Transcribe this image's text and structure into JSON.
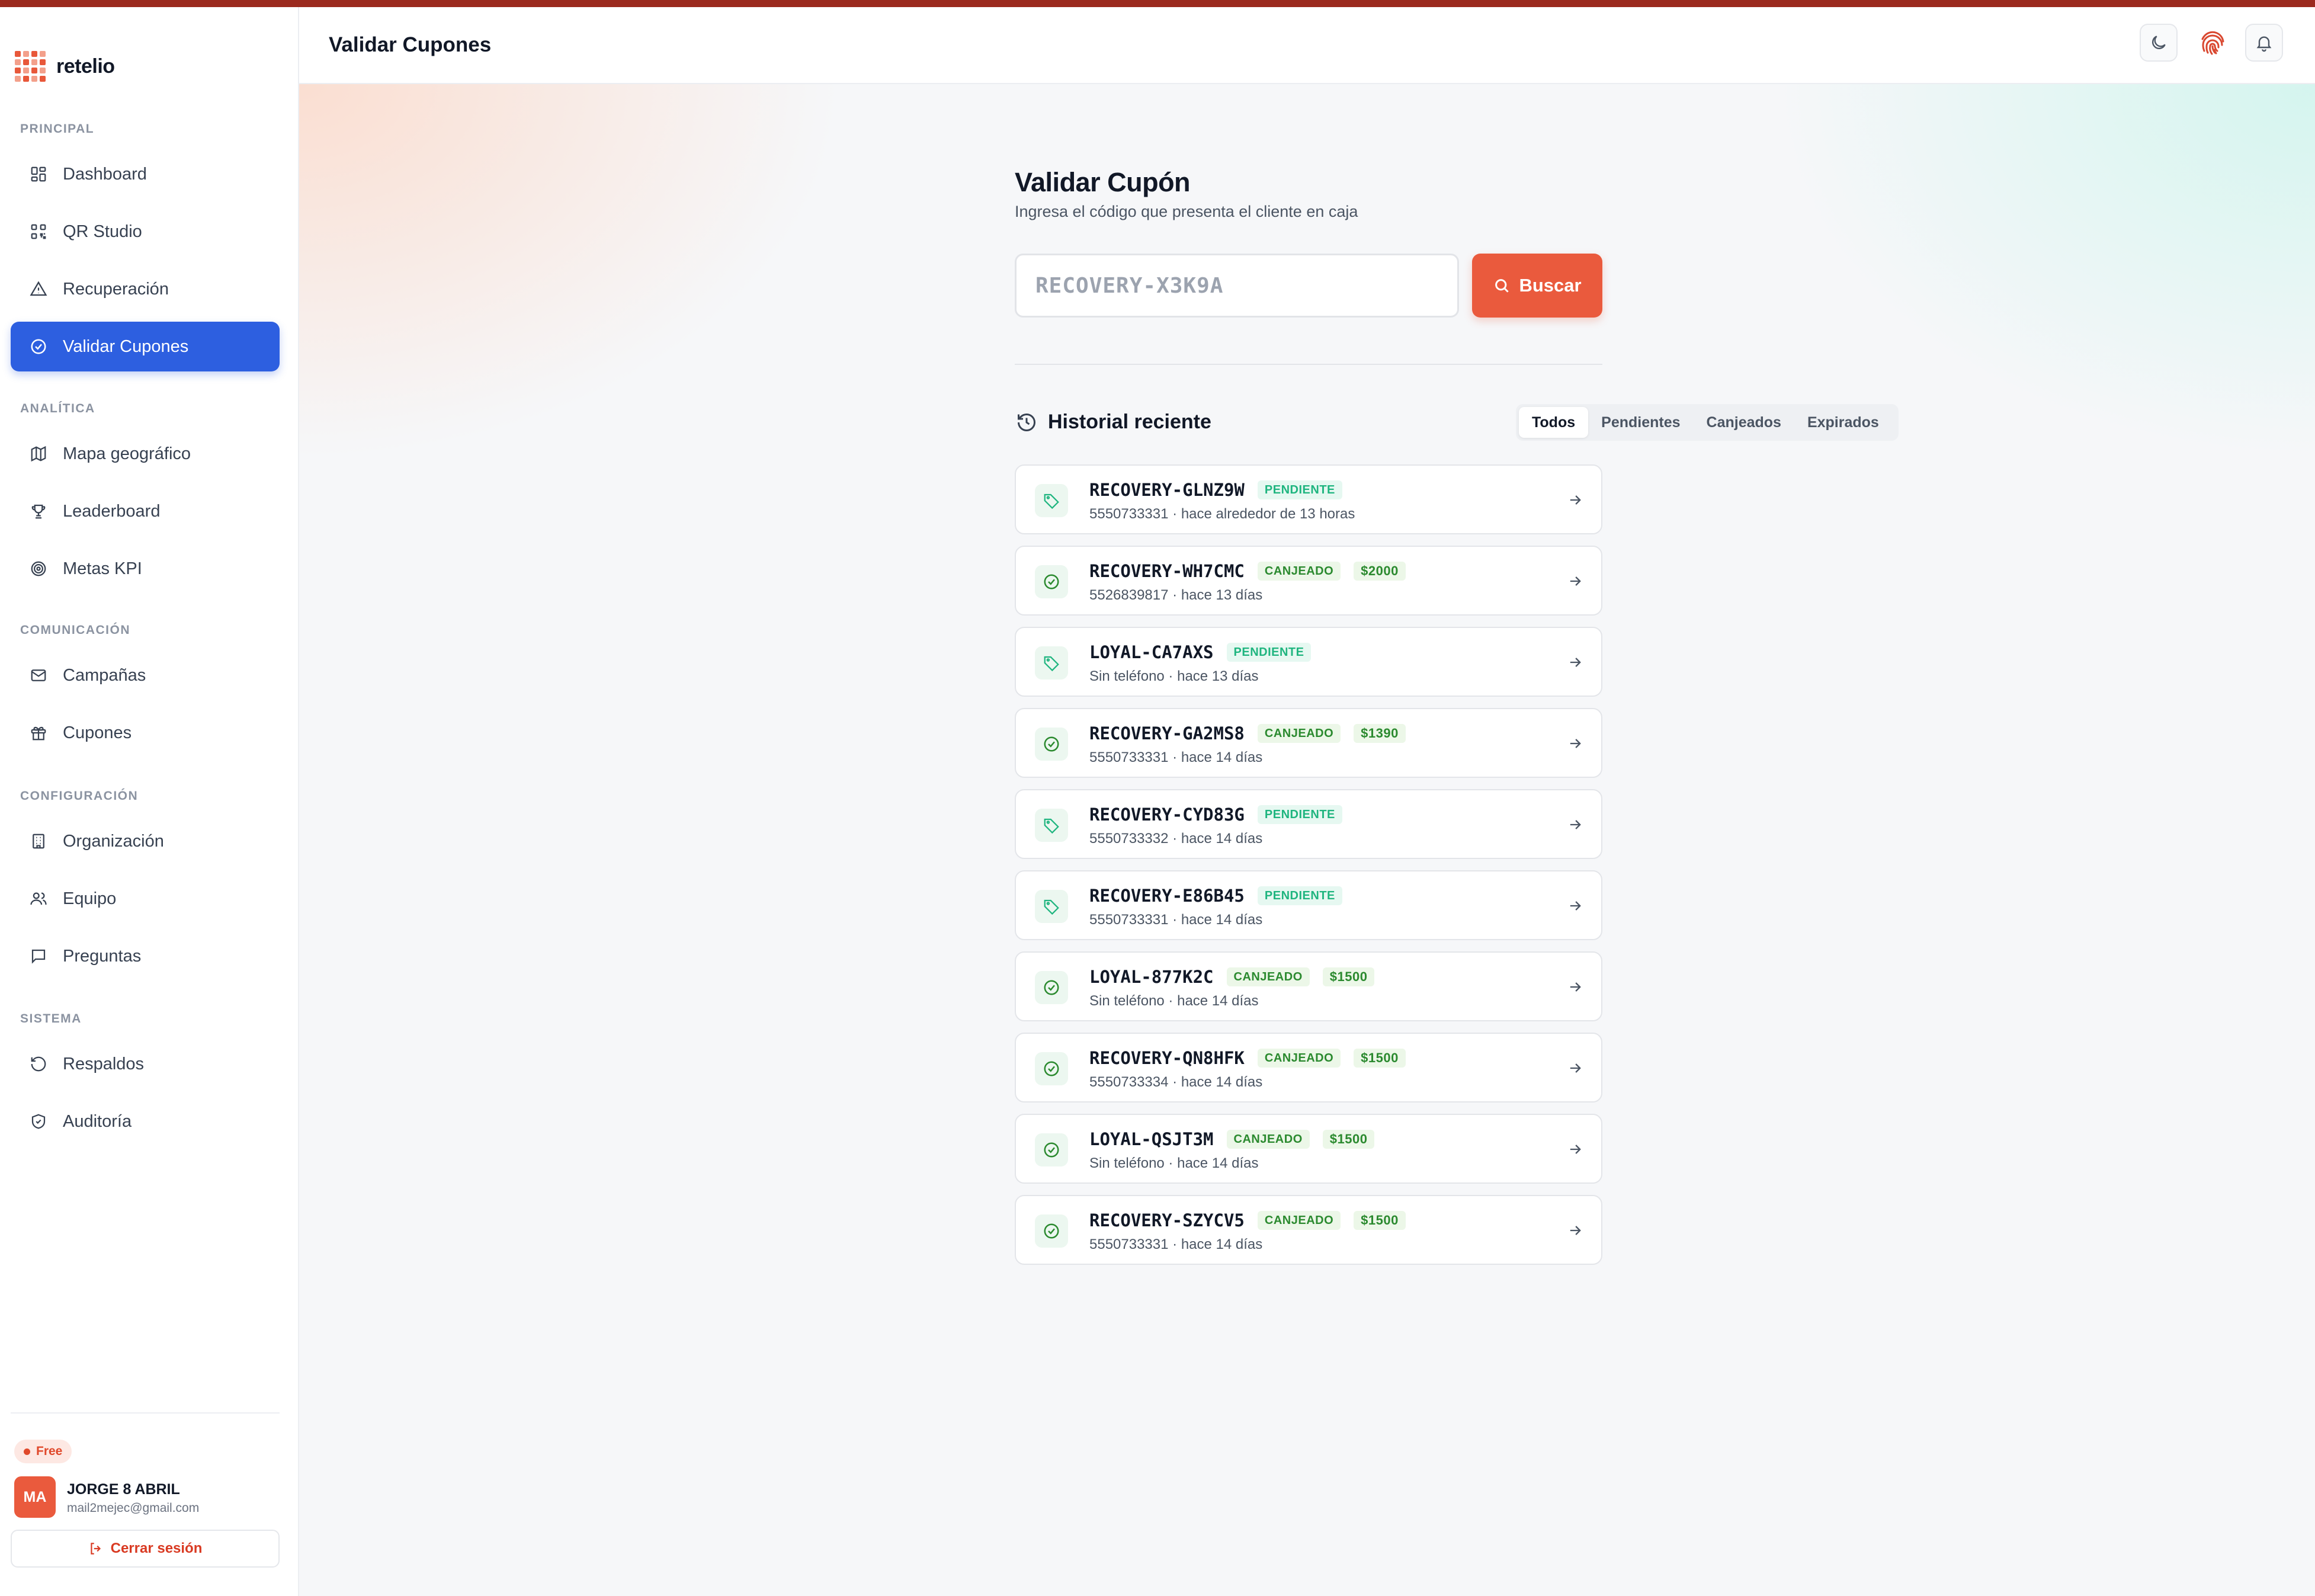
{
  "brand": {
    "name": "retelio"
  },
  "sidebar": {
    "sections": [
      {
        "label": "PRINCIPAL"
      },
      {
        "label": "ANALÍTICA"
      },
      {
        "label": "COMUNICACIÓN"
      },
      {
        "label": "CONFIGURACIÓN"
      },
      {
        "label": "SISTEMA"
      }
    ],
    "items": [
      {
        "label": "Dashboard",
        "icon": "dashboard-icon"
      },
      {
        "label": "QR Studio",
        "icon": "qr-icon"
      },
      {
        "label": "Recuperación",
        "icon": "alert-triangle-icon"
      },
      {
        "label": "Validar Cupones",
        "icon": "check-circle-icon",
        "active": true
      },
      {
        "label": "Mapa geográfico",
        "icon": "map-icon"
      },
      {
        "label": "Leaderboard",
        "icon": "trophy-icon"
      },
      {
        "label": "Metas KPI",
        "icon": "target-icon"
      },
      {
        "label": "Campañas",
        "icon": "mail-icon"
      },
      {
        "label": "Cupones",
        "icon": "gift-icon"
      },
      {
        "label": "Organización",
        "icon": "building-icon"
      },
      {
        "label": "Equipo",
        "icon": "users-icon"
      },
      {
        "label": "Preguntas",
        "icon": "message-square-icon"
      },
      {
        "label": "Respaldos",
        "icon": "history-icon"
      },
      {
        "label": "Auditoría",
        "icon": "shield-check-icon"
      }
    ]
  },
  "account": {
    "plan": "Free",
    "initials": "MA",
    "name": "JORGE 8 ABRIL",
    "email": "mail2mejec@gmail.com",
    "logout_label": "Cerrar sesión"
  },
  "header": {
    "title": "Validar Cupones"
  },
  "validate": {
    "title": "Validar Cupón",
    "subtitle": "Ingresa el código que presenta el cliente en caja",
    "input_placeholder": "RECOVERY-X3K9A",
    "input_value": "",
    "search_label": "Buscar"
  },
  "history": {
    "title": "Historial reciente",
    "tabs": [
      "Todos",
      "Pendientes",
      "Canjeados",
      "Expirados"
    ],
    "active_tab": "Todos",
    "items": [
      {
        "code": "RECOVERY-GLNZ9W",
        "status": "PENDIENTE",
        "amount": "",
        "phone": "5550733331",
        "time": "hace alrededor de 13 horas"
      },
      {
        "code": "RECOVERY-WH7CMC",
        "status": "CANJEADO",
        "amount": "$2000",
        "phone": "5526839817",
        "time": "hace 13 días"
      },
      {
        "code": "LOYAL-CA7AXS",
        "status": "PENDIENTE",
        "amount": "",
        "phone": "Sin teléfono",
        "time": "hace 13 días"
      },
      {
        "code": "RECOVERY-GA2MS8",
        "status": "CANJEADO",
        "amount": "$1390",
        "phone": "5550733331",
        "time": "hace 14 días"
      },
      {
        "code": "RECOVERY-CYD83G",
        "status": "PENDIENTE",
        "amount": "",
        "phone": "5550733332",
        "time": "hace 14 días"
      },
      {
        "code": "RECOVERY-E86B45",
        "status": "PENDIENTE",
        "amount": "",
        "phone": "5550733331",
        "time": "hace 14 días"
      },
      {
        "code": "LOYAL-877K2C",
        "status": "CANJEADO",
        "amount": "$1500",
        "phone": "Sin teléfono",
        "time": "hace 14 días"
      },
      {
        "code": "RECOVERY-QN8HFK",
        "status": "CANJEADO",
        "amount": "$1500",
        "phone": "5550733334",
        "time": "hace 14 días"
      },
      {
        "code": "LOYAL-QSJT3M",
        "status": "CANJEADO",
        "amount": "$1500",
        "phone": "Sin teléfono",
        "time": "hace 14 días"
      },
      {
        "code": "RECOVERY-SZYCV5",
        "status": "CANJEADO",
        "amount": "$1500",
        "phone": "5550733331",
        "time": "hace 14 días"
      }
    ]
  },
  "colors": {
    "accent": "#ea5a3d",
    "primary": "#2d5fe0",
    "pending": "#1fb57f",
    "redeemed": "#2b8a2f",
    "top_bar": "#9b2a1e"
  }
}
